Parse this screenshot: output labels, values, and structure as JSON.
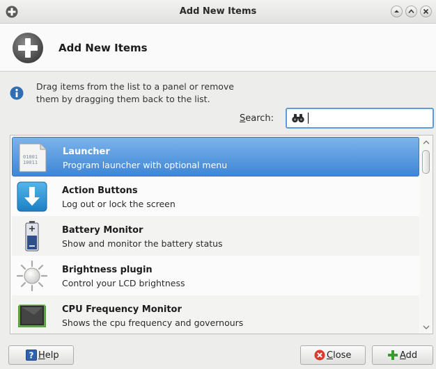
{
  "window": {
    "title": "Add New Items",
    "buttons": [
      "minimize-up",
      "maximize-up",
      "close"
    ]
  },
  "header": {
    "title": "Add New Items"
  },
  "info": {
    "line1": "Drag items from the list to a panel or remove",
    "line2": "them by dragging them back to the list."
  },
  "search": {
    "label_pre": "",
    "label_ul": "S",
    "label_post": "earch:",
    "value": ""
  },
  "items": [
    {
      "name": "Launcher",
      "description": "Program launcher with optional menu",
      "icon": "launcher-icon",
      "selected": true
    },
    {
      "name": "Action Buttons",
      "description": "Log out or lock the screen",
      "icon": "action-buttons-icon",
      "selected": false
    },
    {
      "name": "Battery Monitor",
      "description": "Show and monitor the battery status",
      "icon": "battery-icon",
      "selected": false
    },
    {
      "name": "Brightness plugin",
      "description": "Control your LCD brightness",
      "icon": "brightness-icon",
      "selected": false
    },
    {
      "name": "CPU Frequency Monitor",
      "description": "Shows the cpu frequency and governours",
      "icon": "cpu-icon",
      "selected": false
    }
  ],
  "buttons": {
    "help": {
      "ul": "H",
      "rest": "elp"
    },
    "close": {
      "ul": "C",
      "rest": "lose"
    },
    "add": {
      "ul": "A",
      "rest": "dd"
    }
  },
  "colors": {
    "selection": "#3f86d6",
    "accent_border": "#5c9ad8"
  }
}
